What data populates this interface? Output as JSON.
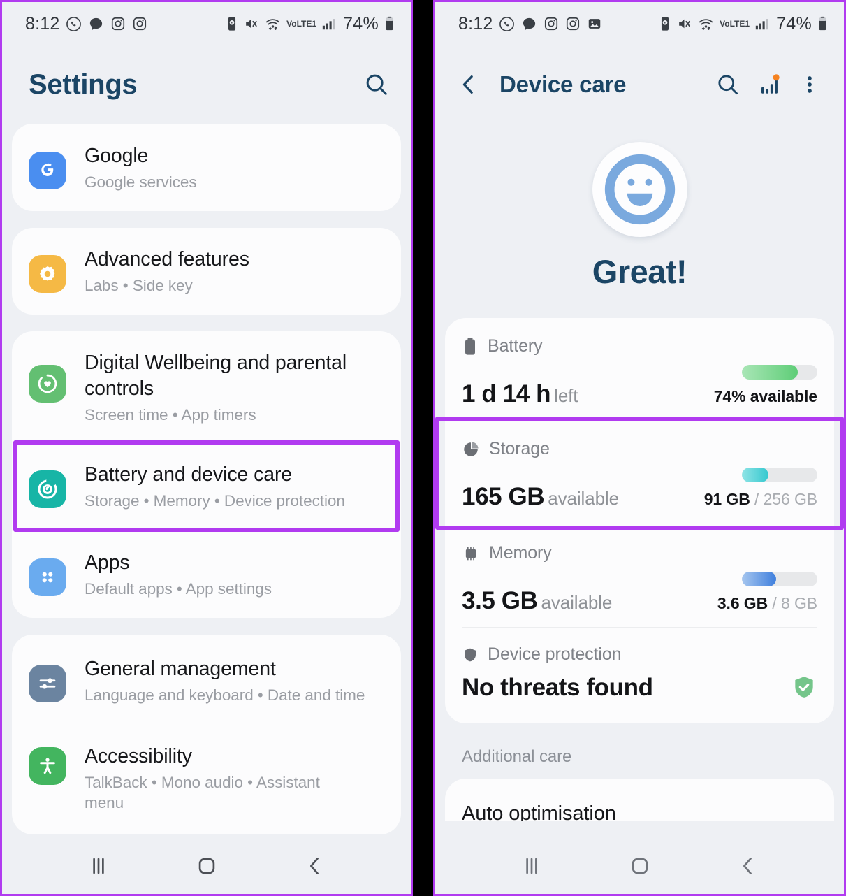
{
  "accent": {
    "highlight": "#b13bf0",
    "title_blue": "#1b4565",
    "battery_bar": "#72d585",
    "storage_bar": "#3fcbd0",
    "memory_bar": "#4a86e0",
    "shield_green": "#74c58a"
  },
  "statusbar": {
    "time": "8:12",
    "battery_percent": "74%",
    "network_label": "VoLTE1",
    "left_icons": [
      "whatsapp-icon",
      "chat-bubble-icon",
      "instagram-icon",
      "instagram-icon",
      "gallery-icon"
    ],
    "right_icons": [
      "battery-saver-icon",
      "mute-icon",
      "wifi-icon",
      "volte-icon",
      "signal-bars-icon",
      "battery-icon"
    ]
  },
  "left_panel": {
    "title": "Settings",
    "search_icon": "search-icon",
    "groups": [
      {
        "rows": [
          {
            "title": "Google",
            "subtitle": "Google services",
            "icon": "google-icon",
            "tile_color": "#4a8ef0",
            "highlighted": false
          }
        ]
      },
      {
        "rows": [
          {
            "title": "Advanced features",
            "subtitle": "Labs • Side key",
            "icon": "advanced-features-icon",
            "tile_color": "#f5b945",
            "highlighted": false
          }
        ]
      },
      {
        "rows": [
          {
            "title": "Digital Wellbeing and parental controls",
            "subtitle": "Screen time • App timers",
            "icon": "digital-wellbeing-icon",
            "tile_color": "#63bf72",
            "highlighted": false
          },
          {
            "title": "Battery and device care",
            "subtitle": "Storage • Memory • Device protection",
            "icon": "battery-device-care-icon",
            "tile_color": "#17b5a6",
            "highlighted": true
          },
          {
            "title": "Apps",
            "subtitle": "Default apps • App settings",
            "icon": "apps-icon",
            "tile_color": "#6aabef",
            "highlighted": false
          }
        ]
      },
      {
        "rows": [
          {
            "title": "General management",
            "subtitle": "Language and keyboard • Date and time",
            "icon": "general-management-icon",
            "tile_color": "#6b84a0",
            "highlighted": false
          },
          {
            "title": "Accessibility",
            "subtitle": "TalkBack • Mono audio • Assistant menu",
            "icon": "accessibility-icon",
            "tile_color": "#43b55f",
            "highlighted": false
          }
        ]
      }
    ]
  },
  "right_panel": {
    "back_icon": "back-arrow-icon",
    "title": "Device care",
    "actions": [
      "search-icon",
      "diagnostics-chart-icon",
      "more-options-icon"
    ],
    "status": {
      "face_icon": "smiley-face-icon",
      "headline": "Great!"
    },
    "items": [
      {
        "icon": "battery-icon",
        "label": "Battery",
        "value": "1 d 14 h",
        "value_unit": "left",
        "detail": "74% available",
        "detail_muted": "",
        "bar_percent": 74,
        "bar_color": "#72d585",
        "highlighted": false
      },
      {
        "icon": "storage-pie-icon",
        "label": "Storage",
        "value": "165 GB",
        "value_unit": "available",
        "detail": "91 GB",
        "detail_muted": "/ 256 GB",
        "bar_percent": 35,
        "bar_color": "#3fcbd0",
        "highlighted": true
      },
      {
        "icon": "memory-chip-icon",
        "label": "Memory",
        "value": "3.5 GB",
        "value_unit": "available",
        "detail": "3.6 GB",
        "detail_muted": "/ 8 GB",
        "bar_percent": 45,
        "bar_color": "#4a86e0",
        "highlighted": false
      },
      {
        "icon": "shield-icon",
        "label": "Device protection",
        "value": "No threats found",
        "value_unit": "",
        "detail": "",
        "detail_muted": "",
        "bar_percent": null,
        "bar_color": "",
        "highlighted": false
      }
    ],
    "additional_care_label": "Additional care",
    "additional_care_first_item": "Auto optimisation"
  },
  "navbar": {
    "recents_icon": "recents-icon",
    "home_icon": "home-icon",
    "back_icon": "back-icon"
  }
}
